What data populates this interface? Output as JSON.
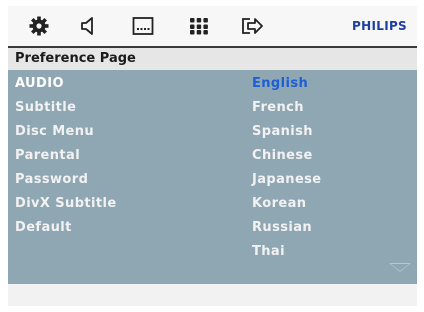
{
  "toolbar": {
    "icons": [
      "gear-icon",
      "speaker-icon",
      "screen-icon",
      "grid-icon",
      "exit-icon"
    ],
    "brand": "PHILIPS",
    "brand_color": "#1f3fa0"
  },
  "page": {
    "title": "Preference Page"
  },
  "menu": {
    "items": [
      {
        "label": "AUDIO",
        "selected": true
      },
      {
        "label": "Subtitle",
        "selected": false
      },
      {
        "label": "Disc Menu",
        "selected": false
      },
      {
        "label": "Parental",
        "selected": false
      },
      {
        "label": "Password",
        "selected": false
      },
      {
        "label": "DivX Subtitle",
        "selected": false
      },
      {
        "label": "Default",
        "selected": false
      }
    ]
  },
  "options": {
    "items": [
      {
        "label": "English",
        "selected": true
      },
      {
        "label": "French",
        "selected": false
      },
      {
        "label": "Spanish",
        "selected": false
      },
      {
        "label": "Chinese",
        "selected": false
      },
      {
        "label": "Japanese",
        "selected": false
      },
      {
        "label": "Korean",
        "selected": false
      },
      {
        "label": "Russian",
        "selected": false
      },
      {
        "label": "Thai",
        "selected": false
      }
    ],
    "scroll_indicator": "chevron-down-icon"
  },
  "colors": {
    "panel": "#8fa6b3",
    "selected_option": "#1d5fd6",
    "menu_text": "#f2f2f2"
  }
}
